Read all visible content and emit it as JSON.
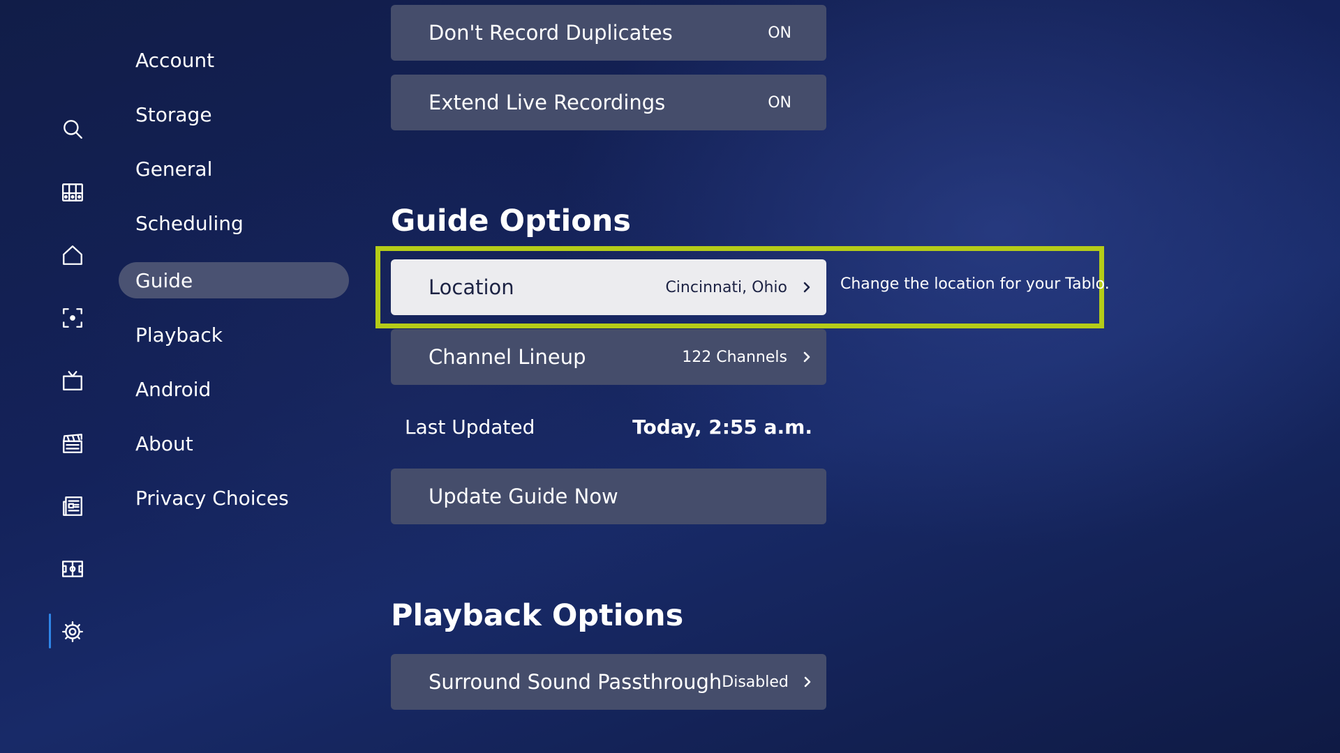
{
  "rail": {
    "icons": [
      "search-icon",
      "grid-guide-icon",
      "home-icon",
      "live-focus-icon",
      "tv-icon",
      "movies-clapper-icon",
      "news-icon",
      "sports-icon",
      "settings-gear-icon"
    ],
    "active": "settings-gear-icon",
    "accent_color": "#2f86e8"
  },
  "menu": {
    "items": [
      {
        "label": "Account"
      },
      {
        "label": "Storage"
      },
      {
        "label": "General"
      },
      {
        "label": "Scheduling"
      },
      {
        "label": "Guide"
      },
      {
        "label": "Playback"
      },
      {
        "label": "Android"
      },
      {
        "label": "About"
      },
      {
        "label": "Privacy Choices"
      }
    ],
    "selected": "Guide"
  },
  "recording": {
    "dont_record_duplicates": {
      "label": "Don't Record Duplicates",
      "value": "ON"
    },
    "extend_live_recordings": {
      "label": "Extend Live Recordings",
      "value": "ON"
    }
  },
  "guide": {
    "title": "Guide Options",
    "location": {
      "label": "Location",
      "value": "Cincinnati, Ohio",
      "hint": "Change the location for your Tablo."
    },
    "channel_lineup": {
      "label": "Channel Lineup",
      "value": "122 Channels"
    },
    "last_updated": {
      "label": "Last Updated",
      "value": "Today, 2:55 a.m."
    },
    "update_now": {
      "label": "Update Guide Now"
    }
  },
  "playback": {
    "title": "Playback Options",
    "surround": {
      "label": "Surround Sound Passthrough",
      "value": "Disabled"
    }
  },
  "colors": {
    "focus_border": "#b5cc18",
    "row_bg": "#454d6b",
    "selected_menu_bg": "#4a5272",
    "focused_row_bg": "#ececef"
  }
}
